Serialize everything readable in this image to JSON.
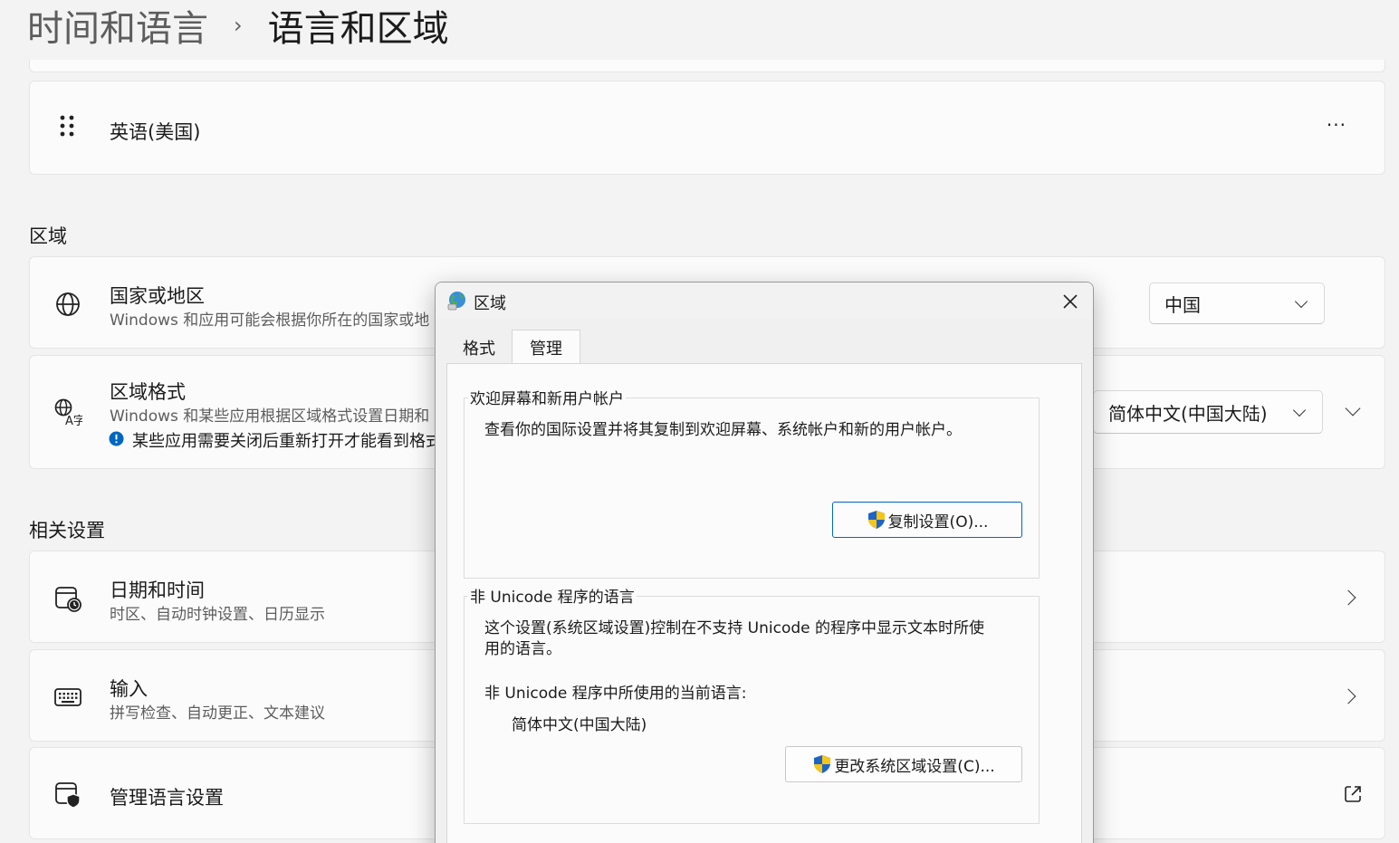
{
  "breadcrumb": {
    "parent": "时间和语言",
    "separator": "›",
    "current": "语言和区域"
  },
  "language_card": {
    "language": "英语(美国)",
    "more": "···"
  },
  "region_section": {
    "title": "区域",
    "country": {
      "title": "国家或地区",
      "subtitle": "Windows 和应用可能会根据你所在的国家或地",
      "value": "中国"
    },
    "format": {
      "title": "区域格式",
      "subtitle": "Windows 和某些应用根据区域格式设置日期和",
      "notice": "某些应用需要关闭后重新打开才能看到格式",
      "value": "简体中文(中国大陆)"
    }
  },
  "related_section": {
    "title": "相关设置",
    "items": [
      {
        "title": "日期和时间",
        "subtitle": "时区、自动时钟设置、日历显示"
      },
      {
        "title": "输入",
        "subtitle": "拼写检查、自动更正、文本建议"
      },
      {
        "title": "管理语言设置",
        "subtitle": ""
      }
    ]
  },
  "dialog": {
    "title": "区域",
    "tabs": [
      "格式",
      "管理"
    ],
    "welcome_group": {
      "legend": "欢迎屏幕和新用户帐户",
      "text": "查看你的国际设置并将其复制到欢迎屏幕、系统帐户和新的用户帐户。",
      "button": "复制设置(O)..."
    },
    "unicode_group": {
      "legend": "非 Unicode 程序的语言",
      "text_line1": "这个设置(系统区域设置)控制在不支持 Unicode 的程序中显示文本时所使",
      "text_line2": "用的语言。",
      "current_label": "非 Unicode 程序中所使用的当前语言:",
      "current_value": "简体中文(中国大陆)",
      "button": "更改系统区域设置(C)..."
    }
  },
  "colors": {
    "accent": "#0067c0",
    "background": "#f3f3f3",
    "card": "#fbfbfb"
  }
}
